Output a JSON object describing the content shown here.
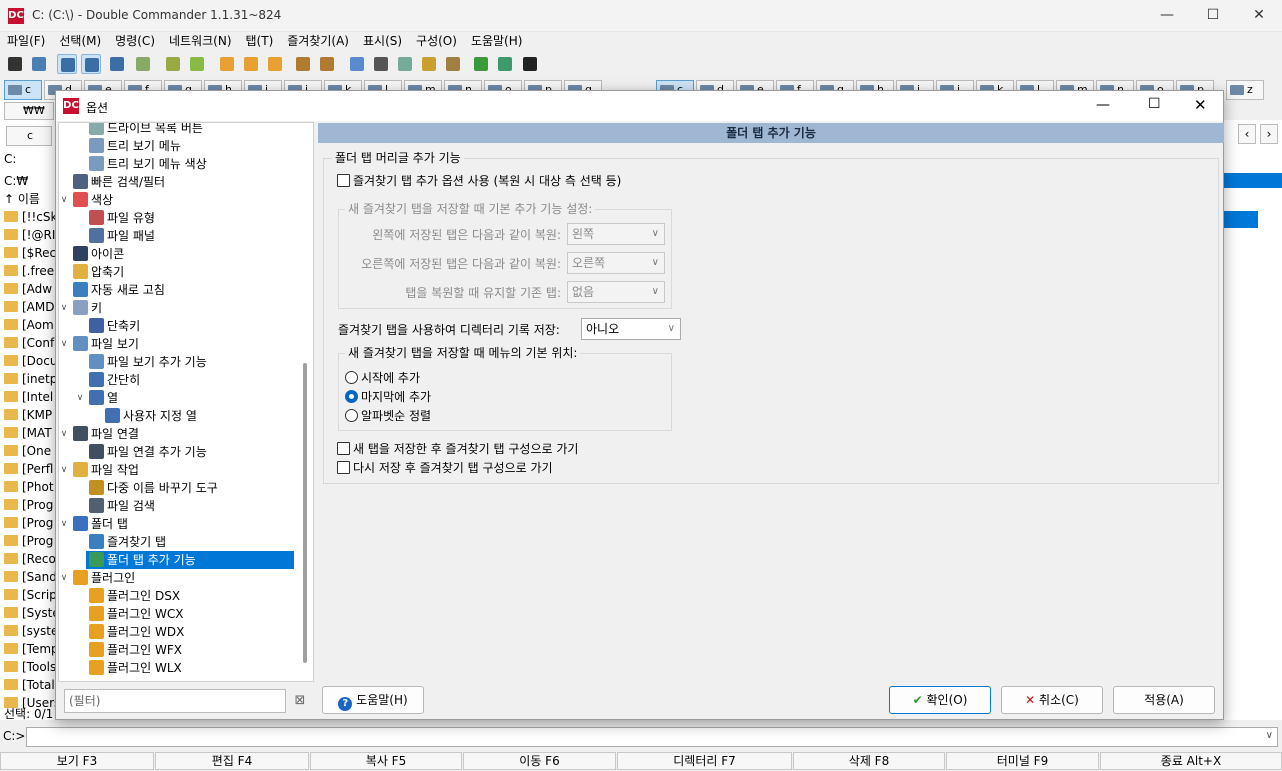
{
  "main": {
    "title": "C: (C:\\) - Double Commander 1.1.31~824",
    "menu": [
      "파일(F)",
      "선택(M)",
      "명령(C)",
      "네트워크(N)",
      "탭(T)",
      "즐겨찾기(A)",
      "표시(S)",
      "구성(O)",
      "도움말(H)"
    ],
    "left_drives": [
      "c",
      "d",
      "e",
      "f",
      "g",
      "h",
      "i",
      "j",
      "k",
      "l",
      "m",
      "n",
      "o",
      "p",
      "q",
      "r",
      "s",
      "z"
    ],
    "right_drives": [
      "c",
      "d",
      "e",
      "f",
      "g",
      "h",
      "i",
      "j",
      "k",
      "l",
      "m",
      "n",
      "o",
      "p",
      "q",
      "r",
      "z"
    ],
    "left_tab": "₩₩",
    "left_path": "C:",
    "left_cur": "C:₩",
    "left_tab2": "c",
    "left_files": [
      "↑ 이름",
      "[!!cSk",
      "[!@RI",
      "[$Rec",
      "[.free",
      "[Adw",
      "[AMD",
      "[Aom",
      "[Conf",
      "[Docu",
      "[inetp",
      "[Intel",
      "[KMP",
      "[MAT",
      "[One",
      "[Perfl",
      "[Phot",
      "[Prog",
      "[Prog",
      "[Prog",
      "[Reco",
      "[Sand",
      "[Scrip",
      "[Syste",
      "[syste",
      "[Temp",
      "[Tools",
      "[Total",
      "[Users"
    ],
    "status": "선택: 0/1",
    "cmd_prompt": "C:>",
    "fkeys": [
      "보기 F3",
      "편집 F4",
      "복사 F5",
      "이동 F6",
      "디렉터리 F7",
      "삭제 F8",
      "터미널 F9",
      "종료 Alt+X"
    ]
  },
  "dialog": {
    "title": "옵션",
    "filter_placeholder": "(필터)",
    "help_label": "도움말(H)",
    "ok_label": "확인(O)",
    "cancel_label": "취소(C)",
    "apply_label": "적용(A)",
    "tree": [
      {
        "label": "드라이브 목록 버튼",
        "level": 2
      },
      {
        "label": "트리 보기 메뉴",
        "level": 2
      },
      {
        "label": "트리 보기 메뉴 색상",
        "level": 2
      },
      {
        "label": "빠른 검색/필터",
        "level": 1
      },
      {
        "label": "색상",
        "level": 1,
        "exp": true
      },
      {
        "label": "파일 유형",
        "level": 2
      },
      {
        "label": "파일 패널",
        "level": 2
      },
      {
        "label": "아이콘",
        "level": 1
      },
      {
        "label": "압축기",
        "level": 1
      },
      {
        "label": "자동 새로 고침",
        "level": 1
      },
      {
        "label": "키",
        "level": 1,
        "exp": true
      },
      {
        "label": "단축키",
        "level": 2
      },
      {
        "label": "파일 보기",
        "level": 1,
        "exp": true
      },
      {
        "label": "파일 보기 추가 기능",
        "level": 2
      },
      {
        "label": "간단히",
        "level": 2
      },
      {
        "label": "열",
        "level": 2,
        "exp": true
      },
      {
        "label": "사용자 지정 열",
        "level": 3
      },
      {
        "label": "파일 연결",
        "level": 1,
        "exp": true
      },
      {
        "label": "파일 연결 추가 기능",
        "level": 2
      },
      {
        "label": "파일 작업",
        "level": 1,
        "exp": true
      },
      {
        "label": "다중 이름 바꾸기 도구",
        "level": 2
      },
      {
        "label": "파일 검색",
        "level": 2
      },
      {
        "label": "폴더 탭",
        "level": 1,
        "exp": true
      },
      {
        "label": "즐겨찾기 탭",
        "level": 2
      },
      {
        "label": "폴더 탭 추가 기능",
        "level": 2,
        "selected": true
      },
      {
        "label": "플러그인",
        "level": 1,
        "exp": true
      },
      {
        "label": "플러그인 DSX",
        "level": 2
      },
      {
        "label": "플러그인 WCX",
        "level": 2
      },
      {
        "label": "플러그인 WDX",
        "level": 2
      },
      {
        "label": "플러그인 WFX",
        "level": 2
      },
      {
        "label": "플러그인 WLX",
        "level": 2
      }
    ],
    "page": {
      "header": "폴더 탭 추가 기능",
      "group_title": "폴더 탭 머리글 추가 기능",
      "use_options": {
        "label": "즐겨찾기 탭 추가 옵션 사용 (복원 시 대상 측 선택 등)",
        "checked": false
      },
      "sub_group_title": "새 즐겨찾기 탭을 저장할 때 기본 추가 기능 설정:",
      "left_restore": {
        "label": "왼쪽에 저장된 탭은 다음과 같이 복원:",
        "value": "왼쪽"
      },
      "right_restore": {
        "label": "오른쪽에 저장된 탭은 다음과 같이 복원:",
        "value": "오른쪽"
      },
      "keep_tabs": {
        "label": "탭을 복원할 때 유지할 기존 탭:",
        "value": "없음"
      },
      "save_history": {
        "label": "즐겨찾기 탭을 사용하여 디렉터리 기록 저장:",
        "value": "아니오"
      },
      "menu_pos_title": "새 즐겨찾기 탭을 저장할 때 메뉴의 기본 위치:",
      "radios": [
        {
          "label": "시작에 추가",
          "checked": false
        },
        {
          "label": "마지막에 추가",
          "checked": true
        },
        {
          "label": "알파벳순 정렬",
          "checked": false
        }
      ],
      "goto_after_save": {
        "label": "새 탭을 저장한 후 즐겨찾기 탭 구성으로 가기",
        "checked": false
      },
      "goto_after_resave": {
        "label": "다시 저장 후 즐겨찾기 탭 구성으로 가기",
        "checked": false
      }
    }
  }
}
